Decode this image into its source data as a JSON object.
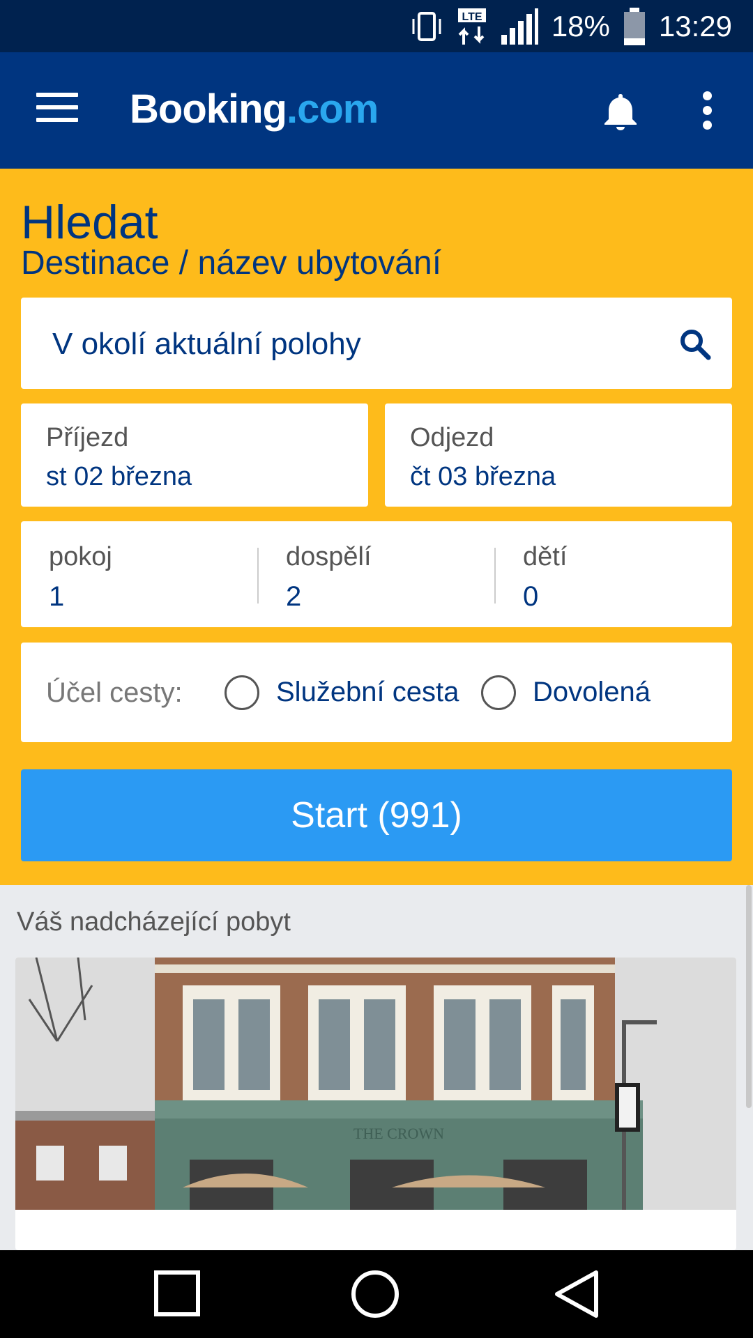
{
  "status_bar": {
    "battery_percent": "18%",
    "time": "13:29",
    "network": "LTE",
    "icons": [
      "vibrate-icon",
      "lte-icon",
      "signal-icon",
      "battery-icon"
    ]
  },
  "app_bar": {
    "logo_main": "Booking",
    "logo_suffix": ".com",
    "icons": [
      "menu-icon",
      "bell-icon",
      "more-vert-icon"
    ]
  },
  "search": {
    "title": "Hledat",
    "subtitle": "Destinace / název ubytování",
    "destination_value": "V okolí aktuální polohy",
    "checkin_label": "Příjezd",
    "checkin_value": "st 02 března",
    "checkout_label": "Odjezd",
    "checkout_value": "čt 03 března",
    "rooms_label": "pokoj",
    "rooms_value": "1",
    "adults_label": "dospělí",
    "adults_value": "2",
    "children_label": "dětí",
    "children_value": "0",
    "purpose_label": "Účel cesty:",
    "purpose_options": [
      "Služební cesta",
      "Dovolená"
    ],
    "start_button": "Start (991)"
  },
  "upcoming": {
    "title": "Váš nadcházející pobyt"
  },
  "colors": {
    "brand_blue": "#003580",
    "brand_yellow": "#febb1b",
    "button_blue": "#2b9af3",
    "logo_accent": "#2aa7ee"
  }
}
